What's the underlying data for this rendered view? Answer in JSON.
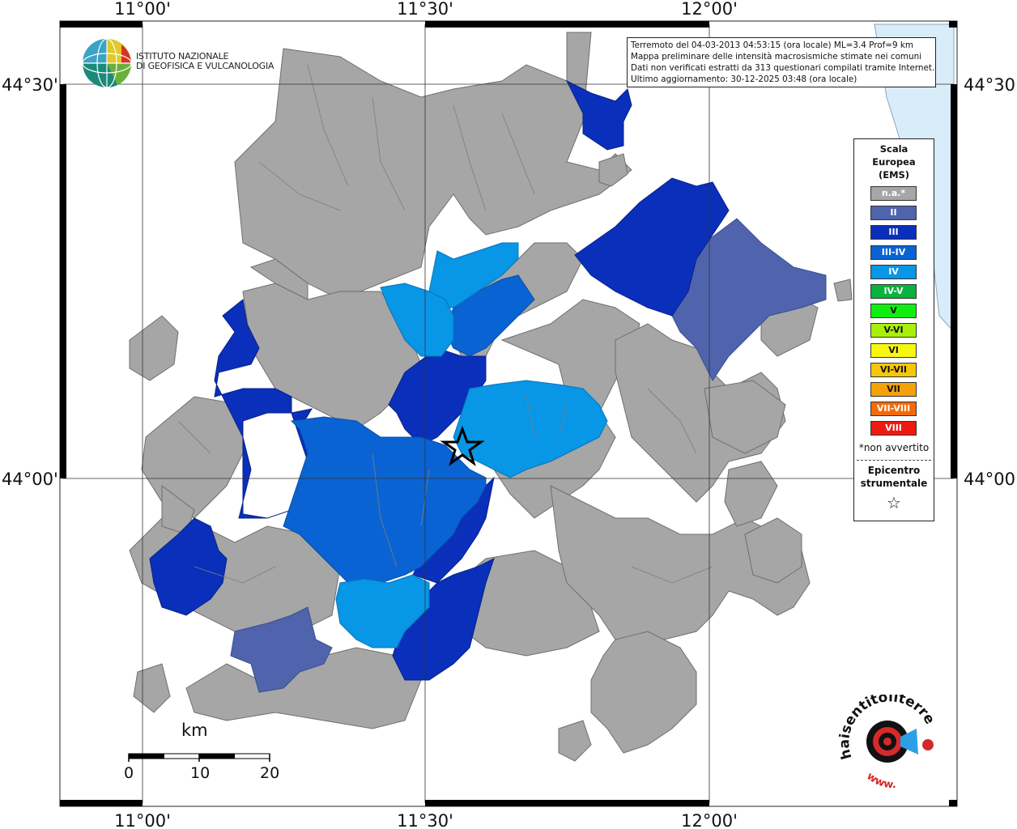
{
  "header": {
    "title_line_1": "Terremoto del 04-03-2013 04:53:15 (ora locale) ML=3.4 Prof=9 km",
    "title_line_2": "Mappa preliminare delle intensità macrosismiche stimate nei comuni",
    "title_line_3": "Dati non verificati estratti da 313 questionari compilati tramite Internet.",
    "title_line_4": "Ultimo aggiornamento: 30-12-2025 03:48 (ora locale)"
  },
  "logo": {
    "line_1": "ISTITUTO NAZIONALE",
    "line_2": "DI GEOFISICA E VULCANOLOGIA"
  },
  "axes": {
    "top_lon": [
      "11°00'",
      "11°30'",
      "12°00'"
    ],
    "bottom_lon": [
      "11°00'",
      "11°30'",
      "12°00'"
    ],
    "left_lat": [
      "44°30'",
      "44°00'"
    ],
    "right_lat": [
      "44°30'",
      "44°00'"
    ]
  },
  "legend": {
    "title_1": "Scala",
    "title_2": "Europea",
    "title_3": "(EMS)",
    "items": [
      {
        "label": "n.a.*",
        "color": "#a6a6a6",
        "text_color": "#ffffff"
      },
      {
        "label": "II",
        "color": "#4f64ad",
        "text_color": "#ffffff"
      },
      {
        "label": "III",
        "color": "#0a2fba",
        "text_color": "#ffffff"
      },
      {
        "label": "III-IV",
        "color": "#0a63d2",
        "text_color": "#ffffff"
      },
      {
        "label": "IV",
        "color": "#0896e6",
        "text_color": "#ffffff"
      },
      {
        "label": "IV-V",
        "color": "#08b43c",
        "text_color": "#ffffff"
      },
      {
        "label": "V",
        "color": "#10ee10",
        "text_color": "#111111"
      },
      {
        "label": "V-VI",
        "color": "#a8f008",
        "text_color": "#111111"
      },
      {
        "label": "VI",
        "color": "#f7f710",
        "text_color": "#111111"
      },
      {
        "label": "VI-VII",
        "color": "#f5c60a",
        "text_color": "#111111"
      },
      {
        "label": "VII",
        "color": "#f5a10a",
        "text_color": "#111111"
      },
      {
        "label": "VII-VIII",
        "color": "#f26a0a",
        "text_color": "#ffffff"
      },
      {
        "label": "VIII",
        "color": "#ee1a12",
        "text_color": "#ffffff"
      }
    ],
    "note": "*non avvertito",
    "epicentre_1": "Epicentro",
    "epicentre_2": "strumentale",
    "star": "☆"
  },
  "scale_bar": {
    "unit": "km",
    "ticks": [
      "0",
      "10",
      "20"
    ]
  },
  "badge": {
    "text": "haisentitoilterremoto.it",
    "url_text": "www."
  },
  "map": {
    "epicentre_marker": "star-icon",
    "colors": {
      "na": "#a6a6a6",
      "II": "#4f64ad",
      "III": "#0a2fba",
      "III-IV": "#0a63d2",
      "IV": "#0896e6",
      "sea": "#d9ecfa"
    }
  }
}
